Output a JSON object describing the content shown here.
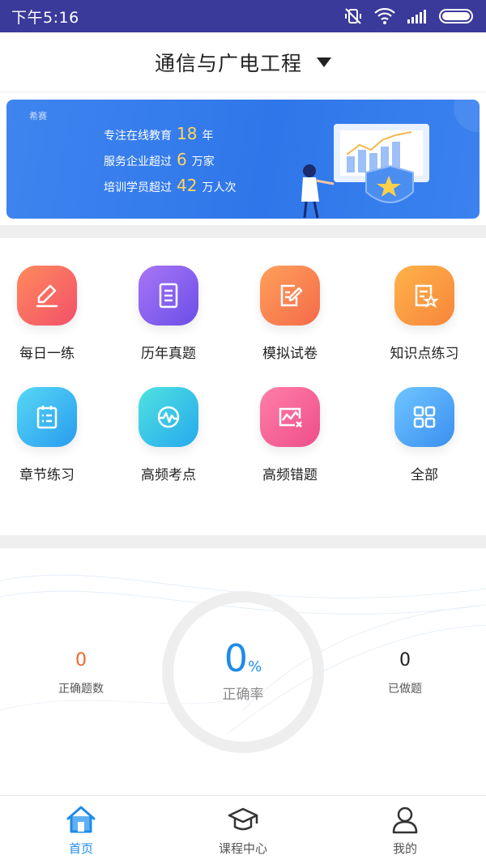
{
  "status_bar": {
    "time": "下午5:16"
  },
  "header": {
    "title": "通信与广电工程"
  },
  "banner": {
    "logo": "希赛",
    "lines": [
      {
        "prefix": "专注在线教育",
        "num": "18",
        "suffix": "年"
      },
      {
        "prefix": "服务企业超过",
        "num": "6",
        "suffix": "万家"
      },
      {
        "prefix": "培训学员超过",
        "num": "42",
        "suffix": "万人次"
      }
    ]
  },
  "menu": {
    "items": [
      {
        "label": "每日一练",
        "icon": "pencil-icon"
      },
      {
        "label": "历年真题",
        "icon": "document-icon"
      },
      {
        "label": "模拟试卷",
        "icon": "edit-paper-icon"
      },
      {
        "label": "知识点练习",
        "icon": "star-document-icon"
      },
      {
        "label": "章节练习",
        "icon": "checklist-icon"
      },
      {
        "label": "高频考点",
        "icon": "pulse-icon"
      },
      {
        "label": "高频错题",
        "icon": "chart-error-icon"
      },
      {
        "label": "全部",
        "icon": "grid-icon"
      }
    ]
  },
  "stats": {
    "correct_count": {
      "value": "0",
      "label": "正确题数"
    },
    "accuracy": {
      "value": "0",
      "unit": "%",
      "label": "正确率"
    },
    "done_count": {
      "value": "0",
      "label": "已做题"
    }
  },
  "colors": {
    "accent": "#1e8be8",
    "correct_count": "#f0662a",
    "status_bar": "#3a3a9a"
  },
  "bottom_nav": {
    "items": [
      {
        "label": "首页",
        "icon": "home-icon",
        "active": true
      },
      {
        "label": "课程中心",
        "icon": "graduation-cap-icon",
        "active": false
      },
      {
        "label": "我的",
        "icon": "user-icon",
        "active": false
      }
    ]
  }
}
